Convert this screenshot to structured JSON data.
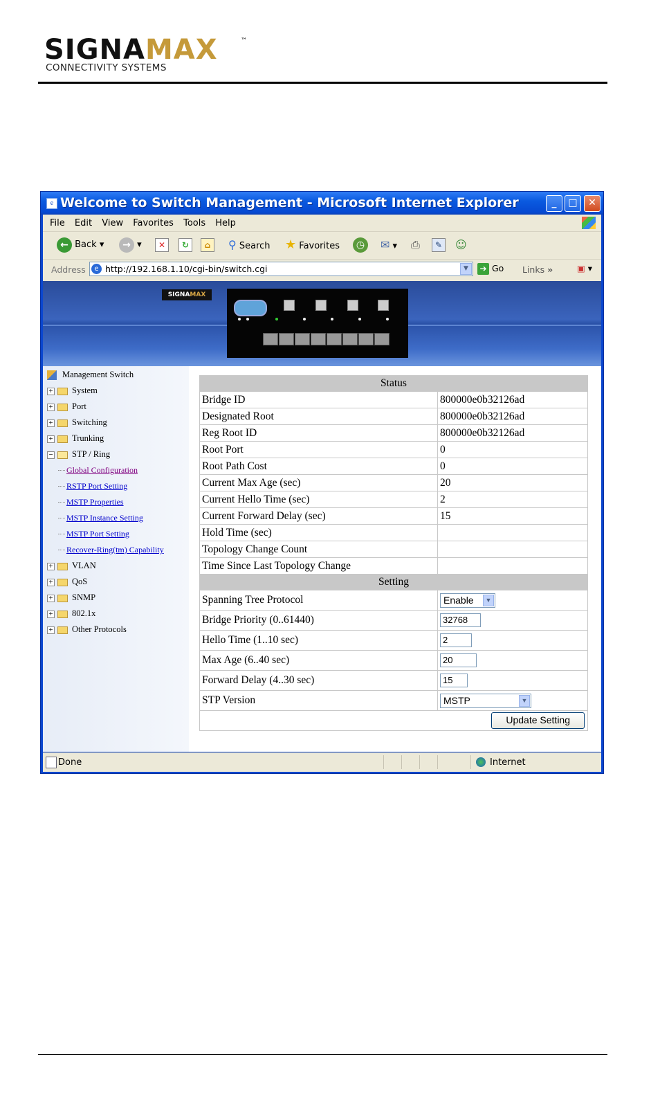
{
  "doc": {
    "logo_text_a": "SIGNA",
    "logo_text_b": "MAX",
    "logo_tm": "™",
    "logo_sub": "CONNECTIVITY SYSTEMS"
  },
  "window": {
    "title": "Welcome to Switch Management - Microsoft Internet Explorer",
    "controls": {
      "min": "_",
      "max": "□",
      "close": "✕"
    }
  },
  "menu": [
    "File",
    "Edit",
    "View",
    "Favorites",
    "Tools",
    "Help"
  ],
  "toolbar": {
    "back": "Back",
    "search": "Search",
    "favorites": "Favorites"
  },
  "address": {
    "label": "Address",
    "url": "http://192.168.1.10/cgi-bin/switch.cgi",
    "go": "Go",
    "links": "Links"
  },
  "banner": {
    "logo_a": "SIGNA",
    "logo_b": "MAX"
  },
  "sidebar": {
    "root": "Management Switch",
    "items": [
      {
        "label": "System"
      },
      {
        "label": "Port"
      },
      {
        "label": "Switching"
      },
      {
        "label": "Trunking"
      },
      {
        "label": "STP / Ring"
      }
    ],
    "stp_sub": [
      {
        "label": "Global Configuration"
      },
      {
        "label": "RSTP Port Setting"
      },
      {
        "label": "MSTP Properties"
      },
      {
        "label": "MSTP Instance Setting"
      },
      {
        "label": "MSTP Port Setting"
      },
      {
        "label": "Recover-Ring(tm) Capability"
      }
    ],
    "items_after": [
      {
        "label": "VLAN"
      },
      {
        "label": "QoS"
      },
      {
        "label": "SNMP"
      },
      {
        "label": "802.1x"
      },
      {
        "label": "Other Protocols"
      }
    ]
  },
  "status": {
    "header": "Status",
    "rows": [
      {
        "label": "Bridge ID",
        "value": "800000e0b32126ad"
      },
      {
        "label": "Designated Root",
        "value": "800000e0b32126ad"
      },
      {
        "label": "Reg Root ID",
        "value": "800000e0b32126ad"
      },
      {
        "label": "Root Port",
        "value": "0"
      },
      {
        "label": "Root Path Cost",
        "value": "0"
      },
      {
        "label": "Current Max Age (sec)",
        "value": "20"
      },
      {
        "label": "Current Hello Time (sec)",
        "value": "2"
      },
      {
        "label": "Current Forward Delay (sec)",
        "value": "15"
      },
      {
        "label": "Hold Time (sec)",
        "value": ""
      },
      {
        "label": "Topology Change Count",
        "value": ""
      },
      {
        "label": "Time Since Last Topology Change",
        "value": ""
      }
    ]
  },
  "setting": {
    "header": "Setting",
    "stp_label": "Spanning Tree Protocol",
    "stp_value": "Enable",
    "priority_label": "Bridge Priority (0..61440)",
    "priority_value": "32768",
    "hello_label": "Hello Time (1..10 sec)",
    "hello_value": "2",
    "maxage_label": "Max Age (6..40 sec)",
    "maxage_value": "20",
    "fwd_label": "Forward Delay (4..30 sec)",
    "fwd_value": "15",
    "version_label": "STP Version",
    "version_value": "MSTP",
    "update_button": "Update Setting"
  },
  "statusbar": {
    "text": "Done",
    "zone": "Internet"
  }
}
